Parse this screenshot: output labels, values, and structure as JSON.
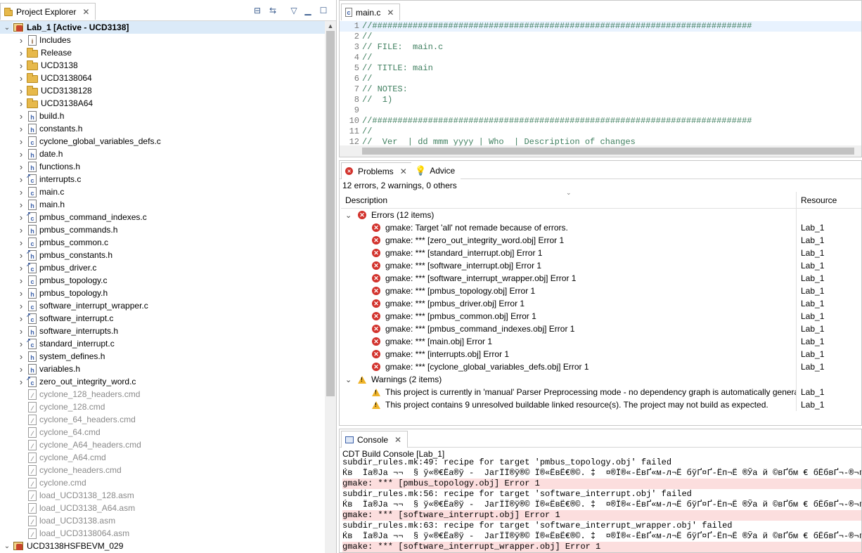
{
  "project_explorer": {
    "tab_label": "Project Explorer",
    "tree": [
      {
        "label": "Lab_1  [Active - UCD3138]",
        "type": "project",
        "level": 0,
        "expanded": true,
        "bold": true,
        "selected": true
      },
      {
        "label": "Includes",
        "type": "includes",
        "level": 1
      },
      {
        "label": "Release",
        "type": "folder",
        "level": 1
      },
      {
        "label": "UCD3138",
        "type": "folder",
        "level": 1
      },
      {
        "label": "UCD3138064",
        "type": "folder",
        "level": 1
      },
      {
        "label": "UCD3138128",
        "type": "folder",
        "level": 1
      },
      {
        "label": "UCD3138A64",
        "type": "folder",
        "level": 1
      },
      {
        "label": "build.h",
        "type": "h",
        "level": 1
      },
      {
        "label": "constants.h",
        "type": "h",
        "level": 1
      },
      {
        "label": "cyclone_global_variables_defs.c",
        "type": "c",
        "level": 1
      },
      {
        "label": "date.h",
        "type": "h",
        "level": 1
      },
      {
        "label": "functions.h",
        "type": "h",
        "level": 1
      },
      {
        "label": "interrupts.c",
        "type": "c-link",
        "level": 1
      },
      {
        "label": "main.c",
        "type": "c",
        "level": 1
      },
      {
        "label": "main.h",
        "type": "h",
        "level": 1
      },
      {
        "label": "pmbus_command_indexes.c",
        "type": "c-link",
        "level": 1
      },
      {
        "label": "pmbus_commands.h",
        "type": "h",
        "level": 1
      },
      {
        "label": "pmbus_common.c",
        "type": "c",
        "level": 1
      },
      {
        "label": "pmbus_constants.h",
        "type": "h-link",
        "level": 1
      },
      {
        "label": "pmbus_driver.c",
        "type": "c-link",
        "level": 1
      },
      {
        "label": "pmbus_topology.c",
        "type": "c",
        "level": 1
      },
      {
        "label": "pmbus_topology.h",
        "type": "h",
        "level": 1
      },
      {
        "label": "software_interrupt_wrapper.c",
        "type": "c",
        "level": 1
      },
      {
        "label": "software_interrupt.c",
        "type": "c-link",
        "level": 1
      },
      {
        "label": "software_interrupts.h",
        "type": "h",
        "level": 1
      },
      {
        "label": "standard_interrupt.c",
        "type": "c-link",
        "level": 1
      },
      {
        "label": "system_defines.h",
        "type": "h",
        "level": 1
      },
      {
        "label": "variables.h",
        "type": "h",
        "level": 1
      },
      {
        "label": "zero_out_integrity_word.c",
        "type": "c-link",
        "level": 1
      },
      {
        "label": "cyclone_128_headers.cmd",
        "type": "cmd",
        "level": 1,
        "noarrow": true
      },
      {
        "label": "cyclone_128.cmd",
        "type": "cmd",
        "level": 1,
        "noarrow": true
      },
      {
        "label": "cyclone_64_headers.cmd",
        "type": "cmd",
        "level": 1,
        "noarrow": true
      },
      {
        "label": "cyclone_64.cmd",
        "type": "cmd",
        "level": 1,
        "noarrow": true
      },
      {
        "label": "cyclone_A64_headers.cmd",
        "type": "cmd",
        "level": 1,
        "noarrow": true
      },
      {
        "label": "cyclone_A64.cmd",
        "type": "cmd",
        "level": 1,
        "noarrow": true
      },
      {
        "label": "cyclone_headers.cmd",
        "type": "cmd",
        "level": 1,
        "noarrow": true
      },
      {
        "label": "cyclone.cmd",
        "type": "cmd",
        "level": 1,
        "noarrow": true
      },
      {
        "label": "load_UCD3138_128.asm",
        "type": "cmd",
        "level": 1,
        "noarrow": true
      },
      {
        "label": "load_UCD3138_A64.asm",
        "type": "cmd",
        "level": 1,
        "noarrow": true
      },
      {
        "label": "load_UCD3138.asm",
        "type": "cmd",
        "level": 1,
        "noarrow": true
      },
      {
        "label": "load_UCD3138064.asm",
        "type": "cmd",
        "level": 1,
        "noarrow": true
      },
      {
        "label": "UCD3138HSFBEVM_029",
        "type": "project",
        "level": 0,
        "expanded": true
      }
    ]
  },
  "editor": {
    "tab_label": "main.c",
    "lines": [
      {
        "n": "1",
        "text": "//###########################################################################",
        "cur": true
      },
      {
        "n": "2",
        "text": "//"
      },
      {
        "n": "3",
        "text": "// FILE:  main.c"
      },
      {
        "n": "4",
        "text": "//"
      },
      {
        "n": "5",
        "text": "// TITLE: main"
      },
      {
        "n": "6",
        "text": "//"
      },
      {
        "n": "7",
        "text": "// NOTES:"
      },
      {
        "n": "8",
        "text": "//  1)"
      },
      {
        "n": "9",
        "text": ""
      },
      {
        "n": "10",
        "text": "//###########################################################################"
      },
      {
        "n": "11",
        "text": "//"
      },
      {
        "n": "12",
        "text": "//  Ver  | dd mmm yyyy | Who  | Description of changes"
      }
    ]
  },
  "problems": {
    "tab_label": "Problems",
    "advice_tab_label": "Advice",
    "summary": "12 errors, 2 warnings, 0 others",
    "col_description": "Description",
    "col_resource": "Resource",
    "rows": [
      {
        "kind": "group-error",
        "text": "Errors (12 items)",
        "resource": ""
      },
      {
        "kind": "error",
        "text": "gmake: Target 'all' not remade because of errors.",
        "resource": "Lab_1"
      },
      {
        "kind": "error",
        "text": "gmake: *** [zero_out_integrity_word.obj] Error 1",
        "resource": "Lab_1"
      },
      {
        "kind": "error",
        "text": "gmake: *** [standard_interrupt.obj] Error 1",
        "resource": "Lab_1"
      },
      {
        "kind": "error",
        "text": "gmake: *** [software_interrupt.obj] Error 1",
        "resource": "Lab_1"
      },
      {
        "kind": "error",
        "text": "gmake: *** [software_interrupt_wrapper.obj] Error 1",
        "resource": "Lab_1"
      },
      {
        "kind": "error",
        "text": "gmake: *** [pmbus_topology.obj] Error 1",
        "resource": "Lab_1"
      },
      {
        "kind": "error",
        "text": "gmake: *** [pmbus_driver.obj] Error 1",
        "resource": "Lab_1"
      },
      {
        "kind": "error",
        "text": "gmake: *** [pmbus_common.obj] Error 1",
        "resource": "Lab_1"
      },
      {
        "kind": "error",
        "text": "gmake: *** [pmbus_command_indexes.obj] Error 1",
        "resource": "Lab_1"
      },
      {
        "kind": "error",
        "text": "gmake: *** [main.obj] Error 1",
        "resource": "Lab_1"
      },
      {
        "kind": "error",
        "text": "gmake: *** [interrupts.obj] Error 1",
        "resource": "Lab_1"
      },
      {
        "kind": "error",
        "text": "gmake: *** [cyclone_global_variables_defs.obj] Error 1",
        "resource": "Lab_1"
      },
      {
        "kind": "group-warning",
        "text": "Warnings (2 items)",
        "resource": ""
      },
      {
        "kind": "warning",
        "text": "This project is currently in 'manual' Parser Preprocessing mode - no dependency graph is automatically generat",
        "resource": "Lab_1"
      },
      {
        "kind": "warning",
        "text": "This project contains 9 unresolved buildable linked resource(s). The project may not build as expected.",
        "resource": "Lab_1"
      }
    ]
  },
  "console": {
    "tab_label": "Console",
    "title": "CDT Build Console [Lab_1]",
    "lines": [
      {
        "text": "subdir_rules.mk:49: recipe for target 'pmbus_topology.obj' failed",
        "err": false
      },
      {
        "text": "Ќв  Їа®Ја ¬¬  § ў«®€Ёа®ў -  ЈагЇЇ®ў®© Ї®«ЁвЁ€®©. ‡  ¤®Ї®«-ЁвҐ«м-л¬Ё бўҐ¤Ґ-Ёп¬Ё ®Ўа й ©вҐбм € бЁбвҐ¬-®¬г  ¤",
        "err": false
      },
      {
        "text": "gmake: *** [pmbus_topology.obj] Error 1",
        "err": true
      },
      {
        "text": "subdir_rules.mk:56: recipe for target 'software_interrupt.obj' failed",
        "err": false
      },
      {
        "text": "Ќв  Їа®Ја ¬¬  § ў«®€Ёа®ў -  ЈагЇЇ®ў®© Ї®«ЁвЁ€®©. ‡  ¤®Ї®«-ЁвҐ«м-л¬Ё бўҐ¤Ґ-Ёп¬Ё ®Ўа й ©вҐбм € бЁбвҐ¬-®¬г  ¤",
        "err": false
      },
      {
        "text": "gmake: *** [software_interrupt.obj] Error 1",
        "err": true
      },
      {
        "text": "subdir_rules.mk:63: recipe for target 'software_interrupt_wrapper.obj' failed",
        "err": false
      },
      {
        "text": "Ќв  Їа®Ја ¬¬  § ў«®€Ёа®ў -  ЈагЇЇ®ў®© Ї®«ЁвЁ€®©. ‡  ¤®Ї®«-ЁвҐ«м-л¬Ё бўҐ¤Ґ-Ёп¬Ё ®Ўа й ©вҐбм € бЁбвҐ¬-®¬г  ¤",
        "err": false
      },
      {
        "text": "gmake: *** [software_interrupt_wrapper.obj] Error 1",
        "err": true
      }
    ]
  }
}
